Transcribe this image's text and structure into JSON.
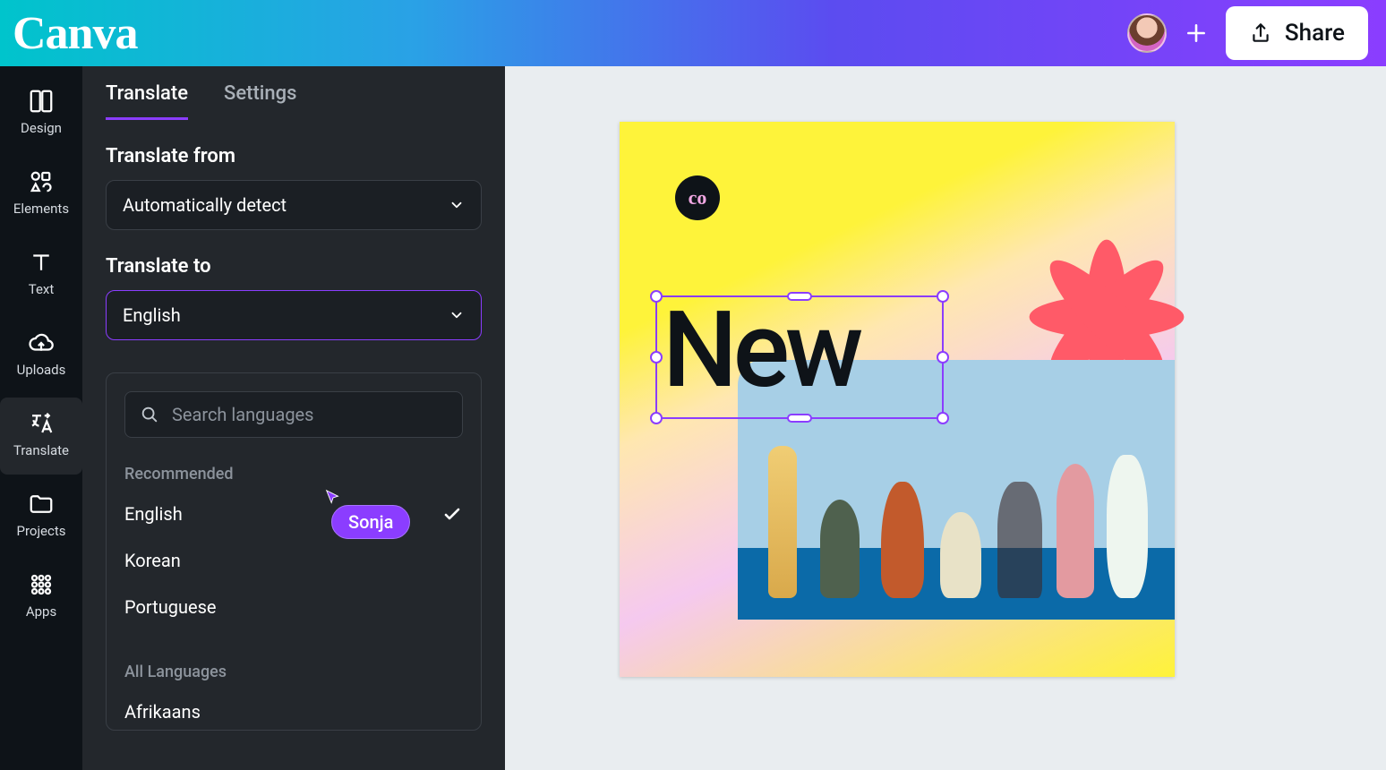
{
  "brand": "Canva",
  "topbar": {
    "share_label": "Share"
  },
  "rail": [
    {
      "id": "design",
      "label": "Design"
    },
    {
      "id": "elements",
      "label": "Elements"
    },
    {
      "id": "text",
      "label": "Text"
    },
    {
      "id": "uploads",
      "label": "Uploads"
    },
    {
      "id": "translate",
      "label": "Translate"
    },
    {
      "id": "projects",
      "label": "Projects"
    },
    {
      "id": "apps",
      "label": "Apps"
    }
  ],
  "panel": {
    "tabs": {
      "translate": "Translate",
      "settings": "Settings"
    },
    "active_tab": "translate",
    "from_label": "Translate from",
    "from_value": "Automatically detect",
    "to_label": "Translate to",
    "to_value": "English",
    "search_placeholder": "Search languages",
    "group_recommended": "Recommended",
    "group_all": "All Languages",
    "recommended": [
      "English",
      "Korean",
      "Portuguese"
    ],
    "selected_language": "English",
    "all_languages": [
      "Afrikaans"
    ]
  },
  "collaborator": {
    "name": "Sonja"
  },
  "canvas": {
    "brand_mark": "co",
    "selected_text": "New"
  }
}
